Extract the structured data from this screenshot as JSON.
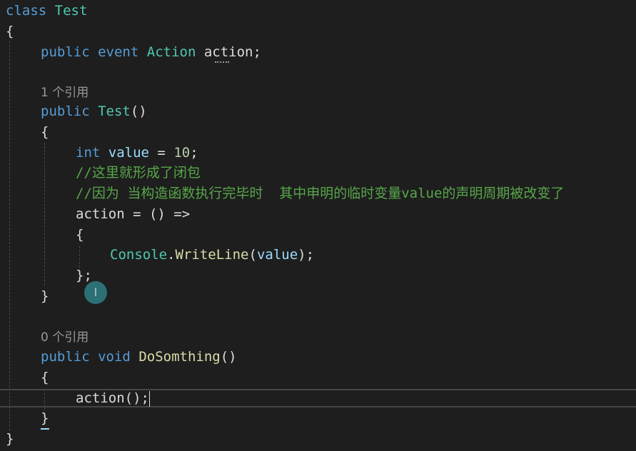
{
  "code": {
    "l1": {
      "kw": "class",
      "name": "Test"
    },
    "l2": {
      "brace": "{"
    },
    "l3": {
      "kw1": "public",
      "kw2": "event",
      "type": "Action",
      "name": "action",
      "semi": ";"
    },
    "l4": {
      "codelens": "1 个引用"
    },
    "l5": {
      "kw": "public",
      "name": "Test",
      "parens": "()"
    },
    "l6": {
      "brace": "{"
    },
    "l7": {
      "kw": "int",
      "name": "value",
      "op": " = ",
      "num": "10",
      "semi": ";"
    },
    "l8": {
      "comment": "//这里就形成了闭包"
    },
    "l9": {
      "comment": "//因为 当构造函数执行完毕时  其中申明的临时变量value的声明周期被改变了"
    },
    "l10": {
      "text": "action = () =>"
    },
    "l11": {
      "brace": "{"
    },
    "l12": {
      "type": "Console",
      "dot": ".",
      "method": "WriteLine",
      "open": "(",
      "arg": "value",
      "close": ");"
    },
    "l13": {
      "text": "};"
    },
    "l14": {
      "brace": "}"
    },
    "l15": {
      "codelens": "0 个引用"
    },
    "l16": {
      "kw1": "public",
      "kw2": "void",
      "method": "DoSomthing",
      "parens": "()"
    },
    "l17": {
      "brace": "{"
    },
    "l18": {
      "text": "action();"
    },
    "l19": {
      "brace": "}"
    },
    "l20": {
      "brace": "}"
    }
  },
  "cursor_glyph": "I",
  "colors": {
    "background": "#1e1e1e",
    "keyword": "#569cd6",
    "type": "#4ec9b0",
    "method": "#dcdcaa",
    "comment": "#57a64a",
    "number": "#b5cea8",
    "parameter": "#9cdcfe"
  }
}
